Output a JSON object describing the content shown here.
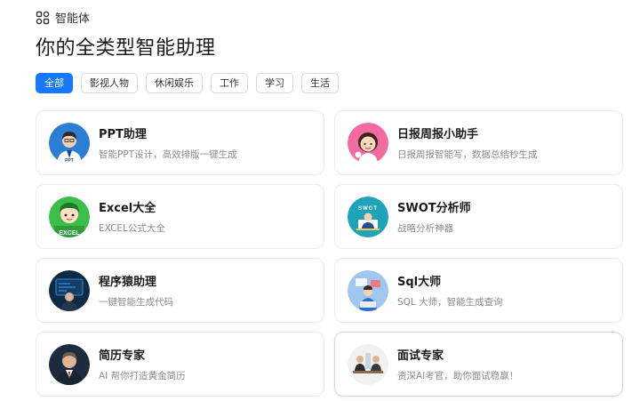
{
  "header": {
    "icon": "apps-icon",
    "title": "智能体"
  },
  "page_title": "你的全类型智能助理",
  "tabs": [
    {
      "label": "全部",
      "active": true
    },
    {
      "label": "影视人物",
      "active": false
    },
    {
      "label": "休闲娱乐",
      "active": false
    },
    {
      "label": "工作",
      "active": false
    },
    {
      "label": "学习",
      "active": false
    },
    {
      "label": "生活",
      "active": false
    }
  ],
  "agents": [
    {
      "name": "PPT助理",
      "desc": "智能PPT设计，高效排版一键生成",
      "avatar_text": "PPT",
      "avatar_bg": "#2a7fd4"
    },
    {
      "name": "日报周报小助手",
      "desc": "日报周报智能写，数据总结秒生成",
      "avatar_bg": "#f26aa0"
    },
    {
      "name": "Excel大全",
      "desc": "EXCEL公式大全",
      "avatar_text": "EXCEL",
      "avatar_bg": "#3cbf4a"
    },
    {
      "name": "SWOT分析师",
      "desc": "战略分析神器",
      "avatar_text": "SWOT",
      "avatar_bg": "#1fa3b8"
    },
    {
      "name": "程序猿助理",
      "desc": "一键智能生成代码",
      "avatar_bg": "#0f2a44"
    },
    {
      "name": "Sql大师",
      "desc": "SQL 大师，智能生成查询",
      "avatar_bg": "#9fc7f0"
    },
    {
      "name": "简历专家",
      "desc": "AI 帮你打造黄金简历",
      "avatar_bg": "#1c2b3d"
    },
    {
      "name": "面试专家",
      "desc": "资深AI考官，助你面试稳赢！",
      "avatar_bg": "#f1f1f1"
    }
  ],
  "colors": {
    "accent": "#1677ff",
    "desc": "#8c8c8c"
  }
}
